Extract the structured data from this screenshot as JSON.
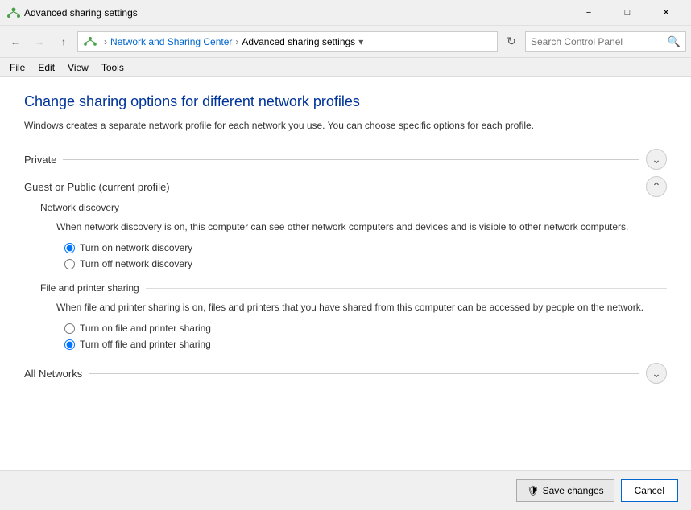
{
  "titleBar": {
    "icon": "network-icon",
    "title": "Advanced sharing settings",
    "minimizeLabel": "−",
    "maximizeLabel": "□",
    "closeLabel": "✕"
  },
  "addressBar": {
    "backLabel": "←",
    "forwardLabel": "→",
    "upLabel": "↑",
    "networkLabel": "Network and Sharing Center",
    "breadcrumbSep1": "›",
    "breadcrumbSep2": "›",
    "currentPage": "Advanced sharing settings",
    "dropdownLabel": "▾",
    "refreshLabel": "⟳",
    "searchPlaceholder": "Search Control Panel",
    "searchIcon": "🔍"
  },
  "menuBar": {
    "file": "File",
    "edit": "Edit",
    "view": "View",
    "tools": "Tools"
  },
  "content": {
    "pageTitle": "Change sharing options for different network profiles",
    "pageDesc": "Windows creates a separate network profile for each network you use. You can choose specific options for each profile.",
    "profiles": [
      {
        "id": "private",
        "label": "Private",
        "expanded": false,
        "toggleIcon": "▾"
      },
      {
        "id": "guest-public",
        "label": "Guest or Public (current profile)",
        "expanded": true,
        "toggleIcon": "▴",
        "subsections": [
          {
            "id": "network-discovery",
            "label": "Network discovery",
            "desc": "When network discovery is on, this computer can see other network computers and devices and is visible to other network computers.",
            "options": [
              {
                "id": "nd-on",
                "label": "Turn on network discovery",
                "checked": true
              },
              {
                "id": "nd-off",
                "label": "Turn off network discovery",
                "checked": false
              }
            ]
          },
          {
            "id": "file-printer-sharing",
            "label": "File and printer sharing",
            "desc": "When file and printer sharing is on, files and printers that you have shared from this computer can be accessed by people on the network.",
            "options": [
              {
                "id": "fps-on",
                "label": "Turn on file and printer sharing",
                "checked": false
              },
              {
                "id": "fps-off",
                "label": "Turn off file and printer sharing",
                "checked": true
              }
            ]
          }
        ]
      },
      {
        "id": "all-networks",
        "label": "All Networks",
        "expanded": false,
        "toggleIcon": "▾"
      }
    ]
  },
  "bottomBar": {
    "saveLabel": "Save changes",
    "cancelLabel": "Cancel",
    "shieldIcon": "🛡"
  }
}
